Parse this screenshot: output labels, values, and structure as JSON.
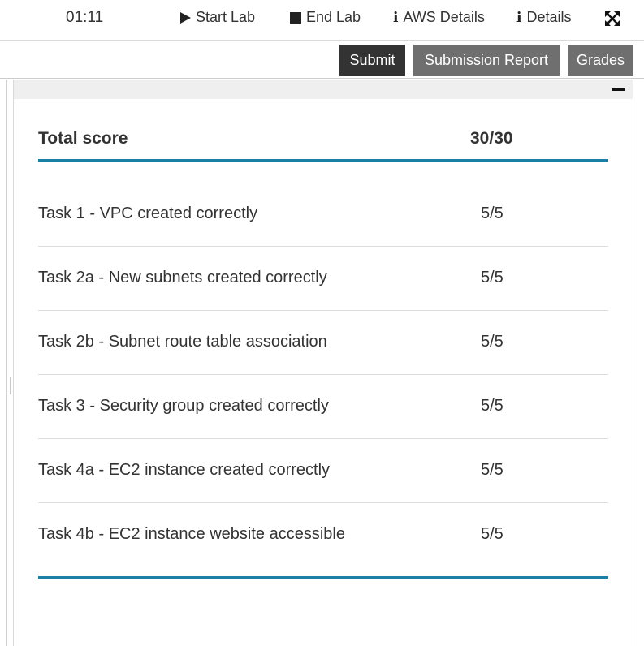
{
  "topbar": {
    "timer": "01:11",
    "start_lab": "Start Lab",
    "end_lab": "End Lab",
    "aws_details": "AWS Details",
    "details": "Details",
    "info_glyph": "i",
    "icons": {
      "start": "play-icon",
      "end": "stop-icon",
      "aws": "info-icon",
      "details": "info-icon",
      "fullscreen": "expand-icon"
    }
  },
  "actions": {
    "submit": "Submit",
    "submission_report": "Submission Report",
    "grades": "Grades"
  },
  "colors": {
    "accent_rule": "#1b7fa6",
    "primary_button": "#333333",
    "secondary_button": "#6f6f6f"
  },
  "grades": {
    "total_label": "Total score",
    "total_value": "30/30",
    "tasks": [
      {
        "name": "Task 1 - VPC created correctly",
        "score": "5/5"
      },
      {
        "name": "Task 2a - New subnets created correctly",
        "score": "5/5"
      },
      {
        "name": "Task 2b - Subnet route table association",
        "score": "5/5"
      },
      {
        "name": "Task 3 - Security group created correctly",
        "score": "5/5"
      },
      {
        "name": "Task 4a - EC2 instance created correctly",
        "score": "5/5"
      },
      {
        "name": "Task 4b - EC2 instance website accessible",
        "score": "5/5"
      }
    ]
  }
}
